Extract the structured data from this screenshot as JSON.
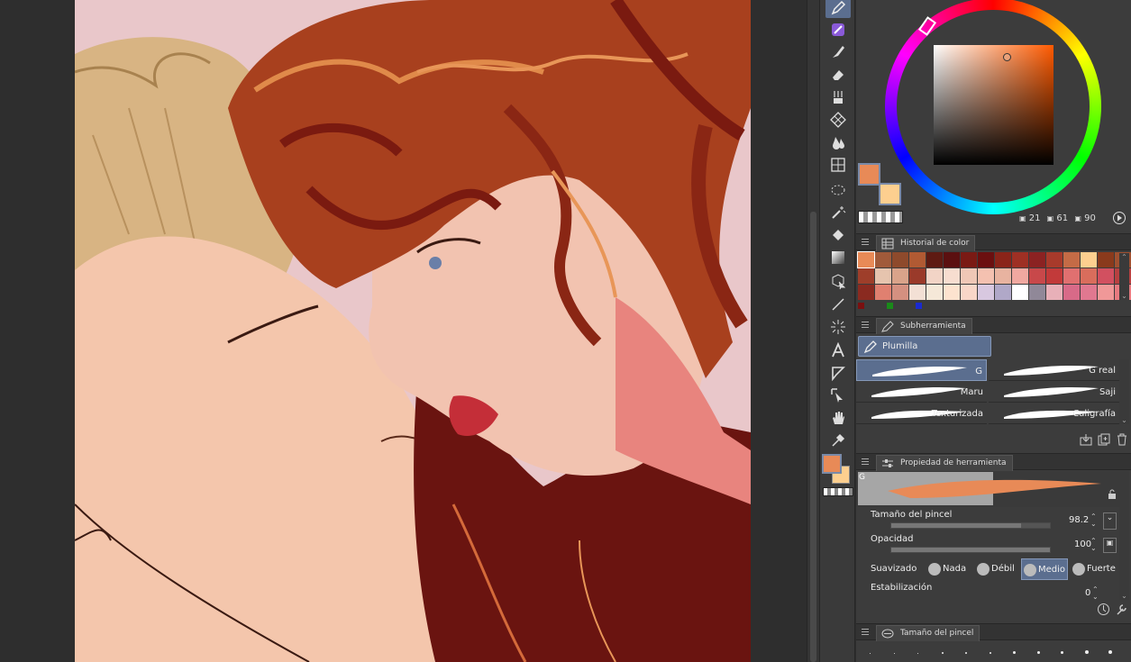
{
  "tabs": {
    "color_history": "Historial de color",
    "subtool": "Subherramienta",
    "tool_property": "Propiedad de herramienta",
    "brush_size": "Tamaño del pincel"
  },
  "color": {
    "main": "#e88a57",
    "sub": "#fdcf8f",
    "h": "21",
    "s": "61",
    "v": "90"
  },
  "history_colors": [
    "#e88a57",
    "#a15a3a",
    "#8e4a2c",
    "#b15a33",
    "#5e1a12",
    "#5b1010",
    "#7a1a14",
    "#6b0f0f",
    "#8a2419",
    "#9e3024",
    "#8b2222",
    "#a83a2b",
    "#c46b46",
    "#fdcf8f",
    "#8a3a1c",
    "#a05030",
    "#9e3e2a",
    "#e6c4ae",
    "#d9a38a",
    "#9a3a2a",
    "#f2d4c6",
    "#f7ddd0",
    "#efc7b6",
    "#f4c1b0",
    "#e8b3a0",
    "#f0a8a0",
    "#c8484a",
    "#c23a3a",
    "#e07070",
    "#d96d5c",
    "#d25060",
    "#b84040",
    "#8a2a20",
    "#e08070",
    "#d49080",
    "#f3e0d5",
    "#f5e8d8",
    "#fde3cf",
    "#f8d6c8",
    "#d8c8e0",
    "#b0a8c8",
    "#ffffff",
    "#908898",
    "#e8b0b8",
    "#d86a88",
    "#e07890",
    "#f09898",
    "#e87a80"
  ],
  "small_colors": [
    "#7a1010",
    "#1a8a1a",
    "#1a2ad0"
  ],
  "subtool": {
    "active": "Plumilla",
    "brushes": [
      {
        "name": "G",
        "active": true
      },
      {
        "name": "G real",
        "active": false
      },
      {
        "name": "Maru",
        "active": false
      },
      {
        "name": "Saji",
        "active": false
      },
      {
        "name": "Texturizada",
        "active": false
      },
      {
        "name": "Caligrafía",
        "active": false
      }
    ]
  },
  "property": {
    "preview_label": "G",
    "brush_size_label": "Tamaño del pincel",
    "brush_size_value": "98.2",
    "brush_size_fraction": 0.82,
    "opacity_label": "Opacidad",
    "opacity_value": "100",
    "opacity_fraction": 1.0,
    "smoothing_label": "Suavizado",
    "smoothing_options": [
      {
        "name": "Nada",
        "active": false
      },
      {
        "name": "Débil",
        "active": false
      },
      {
        "name": "Medio",
        "active": true
      },
      {
        "name": "Fuerte",
        "active": false
      }
    ],
    "stabilization_label": "Estabilización",
    "stabilization_value": "0"
  },
  "tools": [
    "pen-tool-icon",
    "airbrush-icon",
    "brush-icon",
    "eraser-icon",
    "blend-icon",
    "pattern-icon",
    "water-drop-icon",
    "frame-icon",
    "lasso-icon",
    "magic-wand-icon",
    "fill-bucket-icon",
    "gradient-icon",
    "move-layer-icon",
    "line-icon",
    "effect-line-icon",
    "text-icon",
    "balloon-icon",
    "correct-line-icon",
    "hand-icon",
    "eyedropper-icon"
  ]
}
